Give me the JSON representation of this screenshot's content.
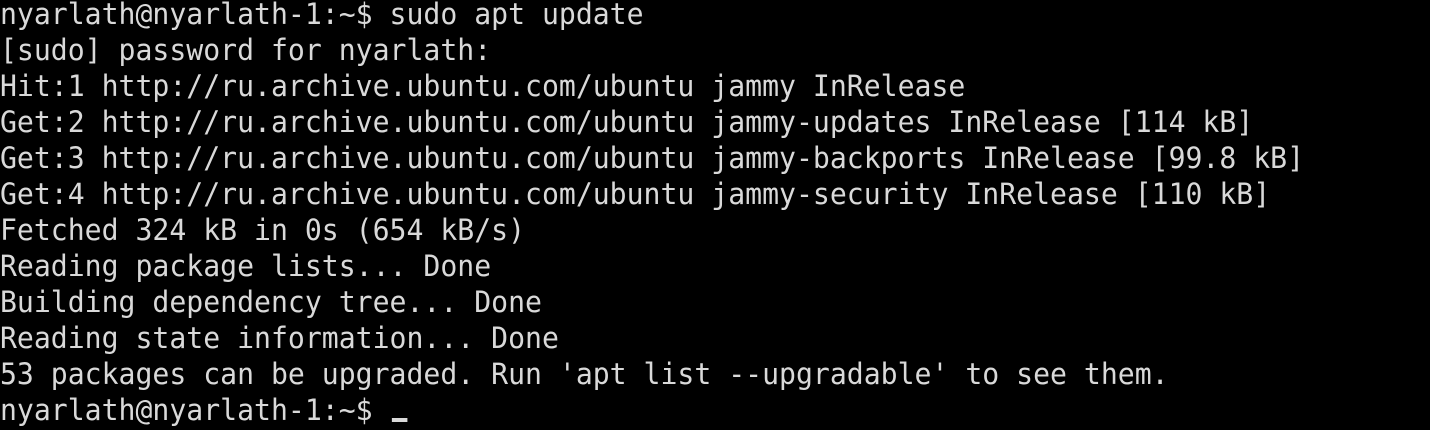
{
  "terminal": {
    "lines": [
      "nyarlath@nyarlath-1:~$ sudo apt update",
      "[sudo] password for nyarlath:",
      "Hit:1 http://ru.archive.ubuntu.com/ubuntu jammy InRelease",
      "Get:2 http://ru.archive.ubuntu.com/ubuntu jammy-updates InRelease [114 kB]",
      "Get:3 http://ru.archive.ubuntu.com/ubuntu jammy-backports InRelease [99.8 kB]",
      "Get:4 http://ru.archive.ubuntu.com/ubuntu jammy-security InRelease [110 kB]",
      "Fetched 324 kB in 0s (654 kB/s)",
      "Reading package lists... Done",
      "Building dependency tree... Done",
      "Reading state information... Done",
      "53 packages can be upgraded. Run 'apt list --upgradable' to see them."
    ],
    "prompt": "nyarlath@nyarlath-1:~$ "
  }
}
